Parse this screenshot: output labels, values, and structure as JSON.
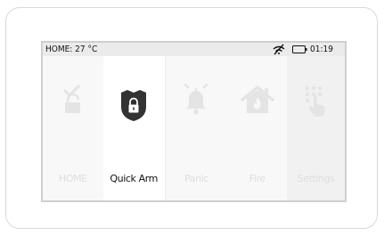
{
  "status": {
    "temperature": "HOME: 27 °C",
    "time": "01:19",
    "icons": [
      "no-signal-icon",
      "battery-icon"
    ]
  },
  "tiles": [
    {
      "label": "HOME",
      "icon": "disarmed-check-lock-icon",
      "active": false
    },
    {
      "label": "Quick Arm",
      "icon": "shield-lock-icon",
      "active": true
    },
    {
      "label": "Panic",
      "icon": "bell-alarm-icon",
      "active": false
    },
    {
      "label": "Fire",
      "icon": "house-fire-icon",
      "active": false
    },
    {
      "label": "Settings",
      "icon": "keypad-touch-icon",
      "active": false
    }
  ],
  "colors": {
    "status_bar": "#ebebeb",
    "active_icon": "#333333",
    "inactive_icon": "#e4e4e4",
    "active_label": "#111111",
    "inactive_label": "#dddddd"
  }
}
